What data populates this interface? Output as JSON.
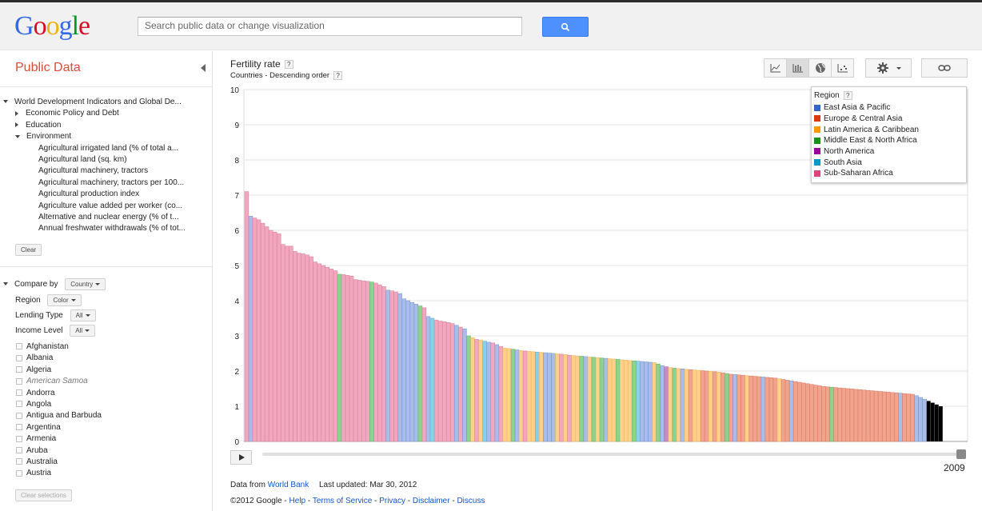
{
  "header": {
    "logo": "Google",
    "search_placeholder": "Search public data or change visualization"
  },
  "sidebar": {
    "title": "Public Data",
    "tree": [
      {
        "label": "World Development Indicators and Global De...",
        "level": 0,
        "expander": "down"
      },
      {
        "label": "Economic Policy and Debt",
        "level": 1,
        "expander": "right"
      },
      {
        "label": "Education",
        "level": 1,
        "expander": "right"
      },
      {
        "label": "Environment",
        "level": 1,
        "expander": "down"
      },
      {
        "label": "Agricultural irrigated land (% of total a...",
        "level": 2,
        "expander": "none"
      },
      {
        "label": "Agricultural land (sq. km)",
        "level": 2,
        "expander": "none"
      },
      {
        "label": "Agricultural machinery, tractors",
        "level": 2,
        "expander": "none"
      },
      {
        "label": "Agricultural machinery, tractors per 100...",
        "level": 2,
        "expander": "none"
      },
      {
        "label": "Agricultural production index",
        "level": 2,
        "expander": "none"
      },
      {
        "label": "Agriculture value added per worker (co...",
        "level": 2,
        "expander": "none"
      },
      {
        "label": "Alternative and nuclear energy (% of t...",
        "level": 2,
        "expander": "none"
      },
      {
        "label": "Annual freshwater withdrawals (% of tot...",
        "level": 2,
        "expander": "none"
      }
    ],
    "clear_label": "Clear",
    "compare_by_label": "Compare by",
    "compare_by_value": "Country",
    "region_label": "Region",
    "region_value": "Color",
    "lending_label": "Lending Type",
    "lending_value": "All",
    "income_label": "Income Level",
    "income_value": "All",
    "countries": [
      "Afghanistan",
      "Albania",
      "Algeria",
      "American Samoa",
      "Andorra",
      "Angola",
      "Antigua and Barbuda",
      "Argentina",
      "Armenia",
      "Aruba",
      "Australia",
      "Austria"
    ],
    "clear_selections_label": "Clear selections"
  },
  "main": {
    "title": "Fertility rate",
    "subtitle": "Countries - Descending order",
    "help": "?",
    "year": "2009",
    "data_from": "Data from",
    "source": "World Bank",
    "last_updated": "Last updated: Mar 30, 2012",
    "copyright": "©2012 Google -",
    "links": [
      "Help",
      "Terms of Service",
      "Privacy",
      "Disclaimer",
      "Discuss"
    ]
  },
  "legend": {
    "title": "Region",
    "items": [
      {
        "label": "East Asia & Pacific",
        "color": "#3366cc"
      },
      {
        "label": "Europe & Central Asia",
        "color": "#dc3912"
      },
      {
        "label": "Latin America & Caribbean",
        "color": "#ff9900"
      },
      {
        "label": "Middle East & North Africa",
        "color": "#109618"
      },
      {
        "label": "North America",
        "color": "#990099"
      },
      {
        "label": "South Asia",
        "color": "#0099c6"
      },
      {
        "label": "Sub-Saharan Africa",
        "color": "#dd4477"
      }
    ]
  },
  "chart_data": {
    "type": "bar",
    "title": "Fertility rate",
    "subtitle": "Countries - Descending order",
    "ylim": [
      0,
      10
    ],
    "yticks": [
      0,
      1,
      2,
      3,
      4,
      5,
      6,
      7,
      8,
      9,
      10
    ],
    "grid": true,
    "legend_position": "top-right",
    "region_colors": {
      "EAP": "#a9bde8",
      "ECA": "#f0a48e",
      "LAC": "#ffd08a",
      "MENA": "#8fd18f",
      "NA": "#c78ac7",
      "SA": "#8ad0e8",
      "SSA": "#f2a7be"
    },
    "series": [
      {
        "name": "Fertility rate",
        "values": [
          7.1,
          6.4,
          6.35,
          6.3,
          6.2,
          6.1,
          6.0,
          5.95,
          5.9,
          5.6,
          5.55,
          5.55,
          5.4,
          5.35,
          5.33,
          5.3,
          5.25,
          5.1,
          5.05,
          5.0,
          4.95,
          4.9,
          4.85,
          4.75,
          4.74,
          4.72,
          4.7,
          4.6,
          4.58,
          4.56,
          4.55,
          4.53,
          4.5,
          4.45,
          4.4,
          4.3,
          4.28,
          4.25,
          4.2,
          4.05,
          4.0,
          3.95,
          3.9,
          3.85,
          3.8,
          3.55,
          3.5,
          3.45,
          3.42,
          3.4,
          3.38,
          3.35,
          3.3,
          3.25,
          3.2,
          3.0,
          2.95,
          2.9,
          2.88,
          2.85,
          2.82,
          2.8,
          2.75,
          2.7,
          2.65,
          2.64,
          2.62,
          2.6,
          2.58,
          2.57,
          2.56,
          2.55,
          2.54,
          2.53,
          2.52,
          2.51,
          2.5,
          2.49,
          2.48,
          2.47,
          2.45,
          2.44,
          2.43,
          2.42,
          2.41,
          2.4,
          2.39,
          2.38,
          2.37,
          2.36,
          2.35,
          2.34,
          2.33,
          2.32,
          2.31,
          2.3,
          2.29,
          2.28,
          2.27,
          2.26,
          2.25,
          2.24,
          2.2,
          2.15,
          2.12,
          2.1,
          2.08,
          2.07,
          2.06,
          2.05,
          2.04,
          2.03,
          2.02,
          2.01,
          2.0,
          1.99,
          1.98,
          1.97,
          1.95,
          1.93,
          1.91,
          1.9,
          1.89,
          1.88,
          1.87,
          1.86,
          1.85,
          1.84,
          1.83,
          1.82,
          1.81,
          1.8,
          1.78,
          1.76,
          1.74,
          1.72,
          1.7,
          1.68,
          1.66,
          1.64,
          1.62,
          1.6,
          1.58,
          1.56,
          1.55,
          1.54,
          1.53,
          1.52,
          1.51,
          1.5,
          1.49,
          1.48,
          1.47,
          1.46,
          1.45,
          1.44,
          1.43,
          1.42,
          1.41,
          1.4,
          1.39,
          1.38,
          1.37,
          1.36,
          1.35,
          1.34,
          1.3,
          1.25,
          1.2,
          1.15,
          1.1,
          1.05,
          1.0
        ],
        "regions": [
          "SSA",
          "EAP",
          "SSA",
          "SSA",
          "SSA",
          "SSA",
          "SSA",
          "SSA",
          "SSA",
          "SSA",
          "SSA",
          "SSA",
          "SSA",
          "SSA",
          "SSA",
          "SSA",
          "SSA",
          "SSA",
          "SSA",
          "SSA",
          "SSA",
          "SSA",
          "SSA",
          "MENA",
          "SSA",
          "SSA",
          "SSA",
          "SSA",
          "SSA",
          "SSA",
          "SSA",
          "MENA",
          "SSA",
          "SSA",
          "SSA",
          "EAP",
          "SSA",
          "SSA",
          "EAP",
          "EAP",
          "EAP",
          "EAP",
          "EAP",
          "MENA",
          "SSA",
          "EAP",
          "SA",
          "SSA",
          "SSA",
          "SSA",
          "SSA",
          "SSA",
          "EAP",
          "SSA",
          "EAP",
          "MENA",
          "LAC",
          "SSA",
          "LAC",
          "SA",
          "EAP",
          "SSA",
          "EAP",
          "SSA",
          "LAC",
          "LAC",
          "MENA",
          "EAP",
          "LAC",
          "SSA",
          "LAC",
          "LAC",
          "SA",
          "LAC",
          "EAP",
          "EAP",
          "EAP",
          "LAC",
          "SSA",
          "LAC",
          "SSA",
          "LAC",
          "LAC",
          "MENA",
          "EAP",
          "LAC",
          "MENA",
          "LAC",
          "MENA",
          "EAP",
          "LAC",
          "LAC",
          "MENA",
          "LAC",
          "LAC",
          "LAC",
          "MENA",
          "SA",
          "EAP",
          "EAP",
          "EAP",
          "LAC",
          "MENA",
          "EAP",
          "NA",
          "LAC",
          "MENA",
          "LAC",
          "EAP",
          "LAC",
          "ECA",
          "LAC",
          "LAC",
          "ECA",
          "ECA",
          "LAC",
          "ECA",
          "LAC",
          "ECA",
          "MENA",
          "ECA",
          "EAP",
          "ECA",
          "ECA",
          "LAC",
          "ECA",
          "ECA",
          "ECA",
          "EAP",
          "ECA",
          "ECA",
          "ECA",
          "LAC",
          "ECA",
          "ECA",
          "EAP",
          "ECA",
          "ECA",
          "ECA",
          "ECA",
          "ECA",
          "ECA",
          "ECA",
          "ECA",
          "ECA",
          "MENA",
          "ECA",
          "ECA",
          "ECA",
          "ECA",
          "ECA",
          "ECA",
          "ECA",
          "ECA",
          "ECA",
          "ECA",
          "ECA",
          "ECA",
          "ECA",
          "ECA",
          "ECA",
          "ECA",
          "EAP",
          "ECA",
          "ECA",
          "ECA",
          "EAP",
          "EAP",
          "EAP"
        ]
      }
    ]
  }
}
